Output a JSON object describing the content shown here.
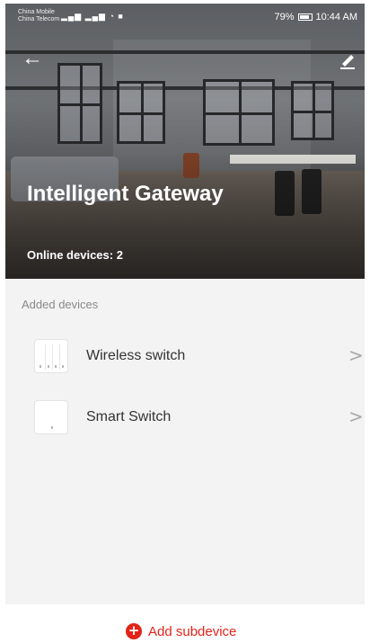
{
  "status_bar": {
    "carrier_1": "China Mobile",
    "carrier_2": "China Telecom",
    "signal_icons": "signal-wifi-icons",
    "battery_percent": "79%",
    "time": "10:44 AM"
  },
  "header": {
    "back_icon": "back-arrow-icon",
    "edit_icon": "edit-pencil-icon",
    "title": "Intelligent Gateway",
    "online_devices": "Online devices: 2"
  },
  "devices": {
    "section_label": "Added devices",
    "items": [
      {
        "name": "Wireless switch",
        "icon": "wireless-switch-icon",
        "chevron": ">"
      },
      {
        "name": "Smart Switch",
        "icon": "smart-switch-icon",
        "chevron": ">"
      }
    ]
  },
  "actions": {
    "add_subdevice_label": "Add subdevice",
    "add_icon_glyph": "+"
  },
  "colors": {
    "accent": "#e1241a",
    "panel_bg": "#f3f3f3",
    "text_primary": "#333333",
    "text_secondary": "#8a8a8a"
  }
}
